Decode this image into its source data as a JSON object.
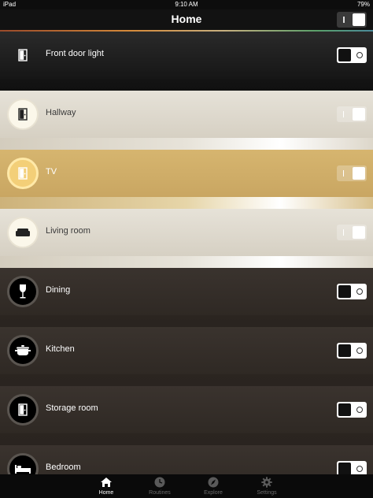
{
  "status_bar": {
    "device": "iPad",
    "time": "9:10 AM",
    "battery": "79%"
  },
  "nav": {
    "title": "Home",
    "master_toggle": "on"
  },
  "rooms": [
    {
      "name": "Front door light",
      "icon": "door-icon",
      "state": "off",
      "theme": "dark-top"
    },
    {
      "name": "Hallway",
      "icon": "door-icon",
      "state": "on",
      "theme": "light"
    },
    {
      "name": "TV",
      "icon": "door-icon",
      "state": "on",
      "theme": "gold"
    },
    {
      "name": "Living room",
      "icon": "sofa-icon",
      "state": "on",
      "theme": "light"
    },
    {
      "name": "Dining",
      "icon": "wine-glass-icon",
      "state": "off",
      "theme": "brown"
    },
    {
      "name": "Kitchen",
      "icon": "cooking-pot-icon",
      "state": "off",
      "theme": "brown"
    },
    {
      "name": "Storage room",
      "icon": "door-icon",
      "state": "off",
      "theme": "brown"
    },
    {
      "name": "Bedroom",
      "icon": "bed-icon",
      "state": "off",
      "theme": "brown"
    }
  ],
  "tabs": [
    {
      "label": "Home",
      "icon": "home-icon",
      "active": true
    },
    {
      "label": "Routines",
      "icon": "clock-icon",
      "active": false
    },
    {
      "label": "Explore",
      "icon": "compass-icon",
      "active": false
    },
    {
      "label": "Settings",
      "icon": "gear-icon",
      "active": false
    }
  ],
  "colors": {
    "gold": "#d2b06a",
    "light": "#d9d4c8",
    "brown": "#332d28",
    "dark": "#1b1b1b"
  }
}
